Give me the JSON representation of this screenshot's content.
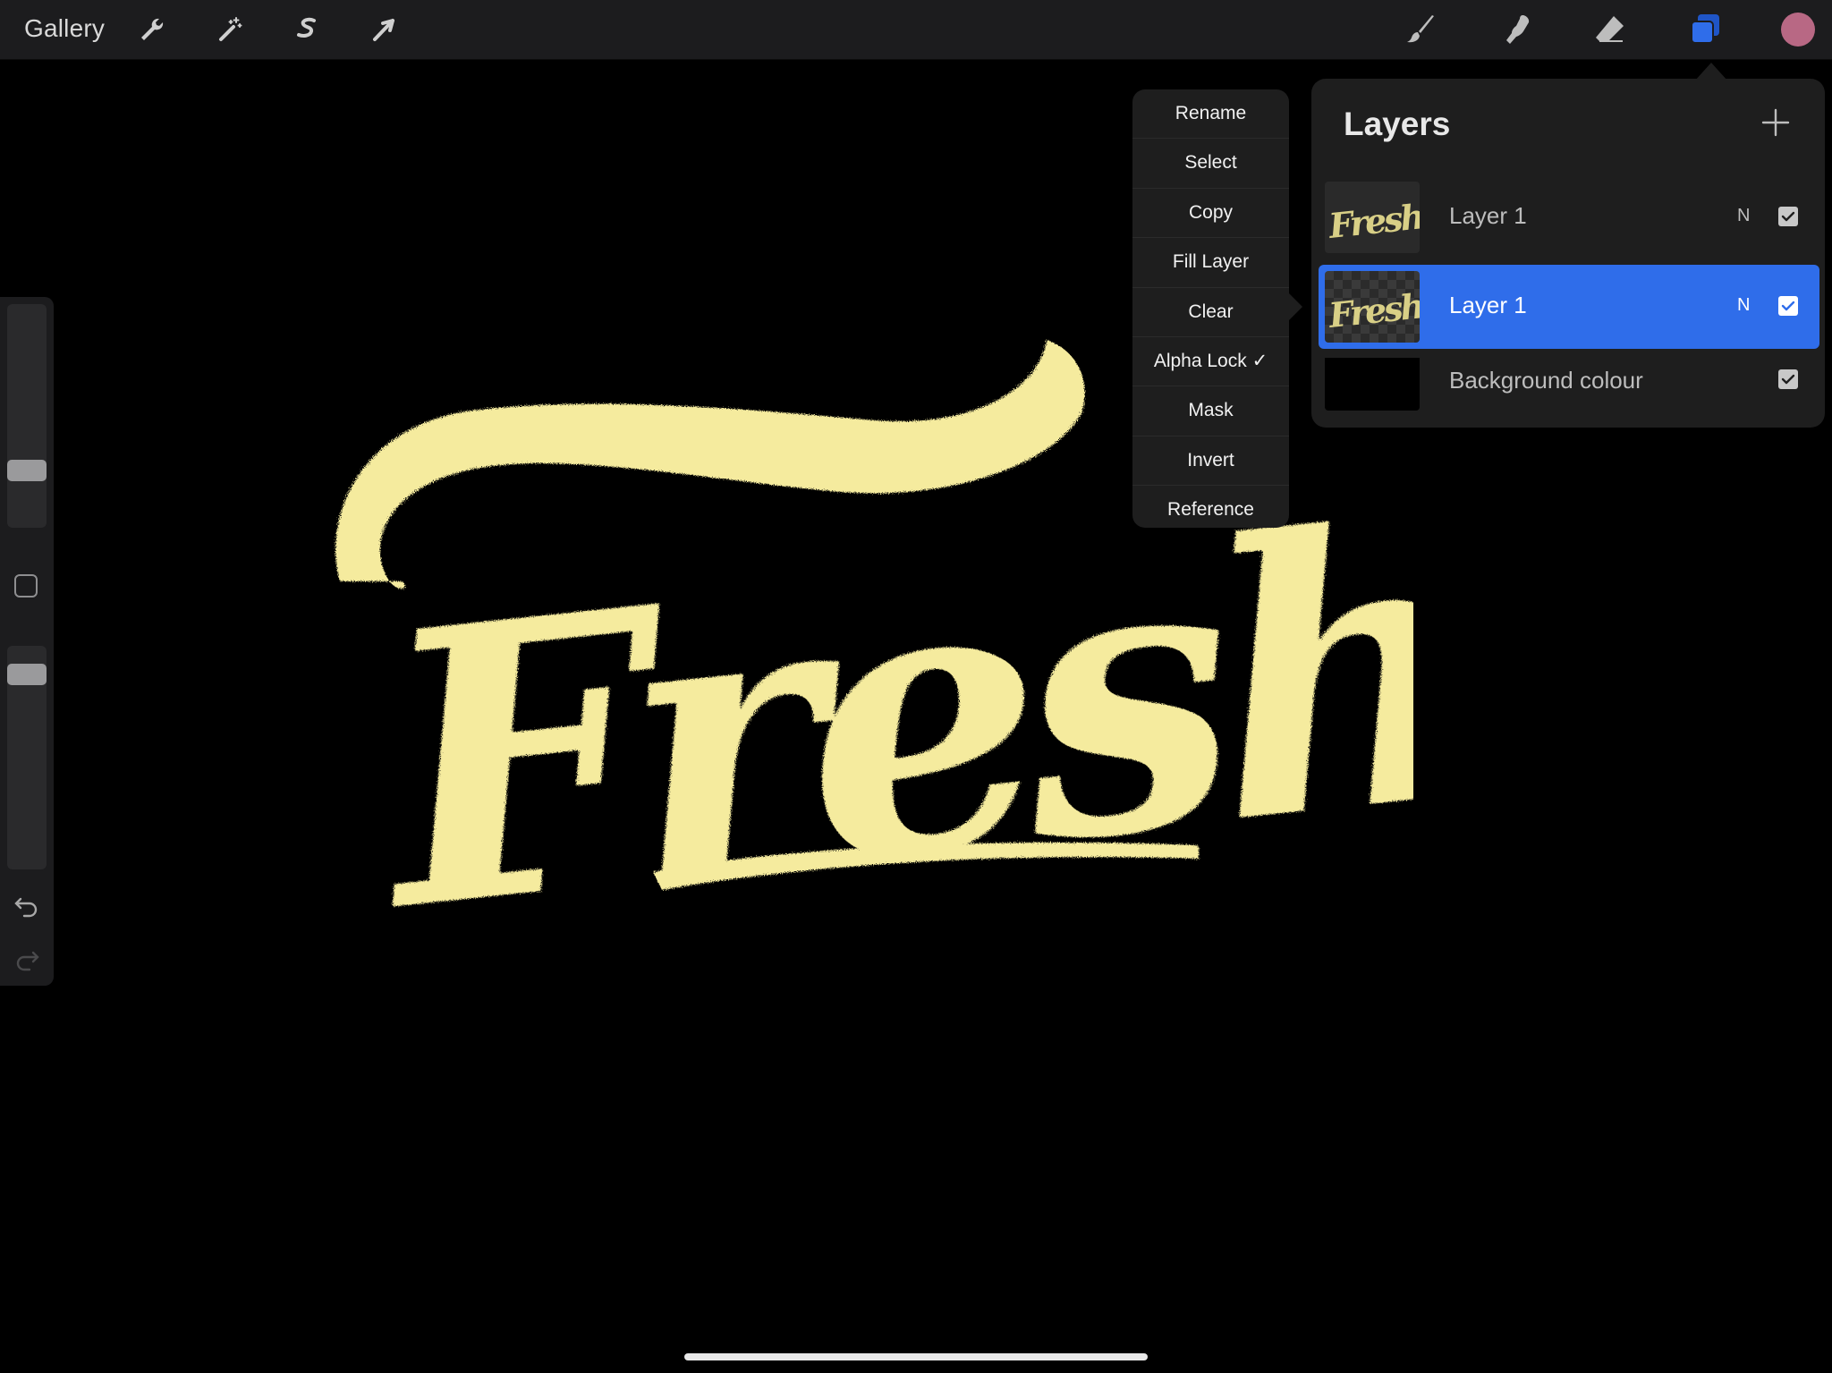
{
  "toolbar": {
    "gallery_label": "Gallery",
    "left_tools": [
      "wrench-icon",
      "magic-wand-icon",
      "selection-s-icon",
      "transform-arrow-icon"
    ],
    "right_tools": [
      "brush-icon",
      "smudge-icon",
      "eraser-icon",
      "layers-icon"
    ],
    "active_tool": "layers-icon",
    "current_color": "#b86884"
  },
  "sidebar": {
    "brush_size_level": 0.34,
    "opacity_level": 0.12
  },
  "canvas": {
    "artwork_text": "Fresh",
    "artwork_color": "#f5eb9e",
    "background_color": "#000000"
  },
  "context_menu": {
    "items": [
      "Rename",
      "Select",
      "Copy",
      "Fill Layer",
      "Clear",
      "Alpha Lock ✓",
      "Mask",
      "Invert",
      "Reference"
    ]
  },
  "layers_panel": {
    "title": "Layers",
    "layers": [
      {
        "name": "Layer 1",
        "blend": "N",
        "visible": true,
        "selected": false,
        "thumb_text": "Fresh"
      },
      {
        "name": "Layer 1",
        "blend": "N",
        "visible": true,
        "selected": true,
        "thumb_text": "Fresh"
      },
      {
        "name": "Background colour",
        "blend": "",
        "visible": true,
        "selected": false
      }
    ]
  }
}
